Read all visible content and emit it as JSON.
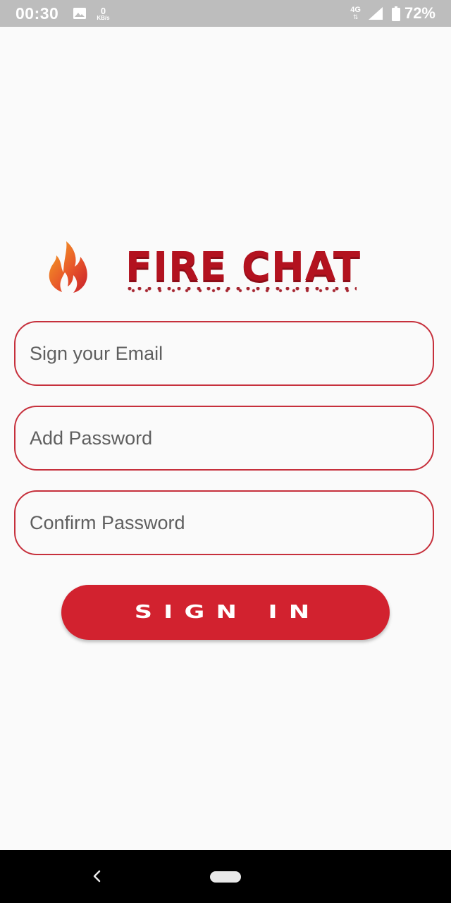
{
  "status_bar": {
    "time": "00:30",
    "speed_value": "0",
    "speed_unit": "KB/s",
    "network_type": "4G",
    "battery_percent": "72%",
    "icons": [
      "image-icon",
      "signal-icon",
      "battery-icon"
    ]
  },
  "logo": {
    "icon": "flame-icon",
    "title": "FIRE CHAT"
  },
  "form": {
    "email_placeholder": "Sign your Email",
    "password_placeholder": "Add Password",
    "confirm_placeholder": "Confirm Password",
    "submit_label": "SIGN IN"
  },
  "nav_bar": {
    "icons": [
      "back-icon",
      "home-pill-icon"
    ]
  },
  "colors": {
    "accent": "#d2222f",
    "title_red": "#b3121f",
    "field_border": "#c6303c",
    "status_bar": "#bdbdbd",
    "background": "#fafafa"
  }
}
